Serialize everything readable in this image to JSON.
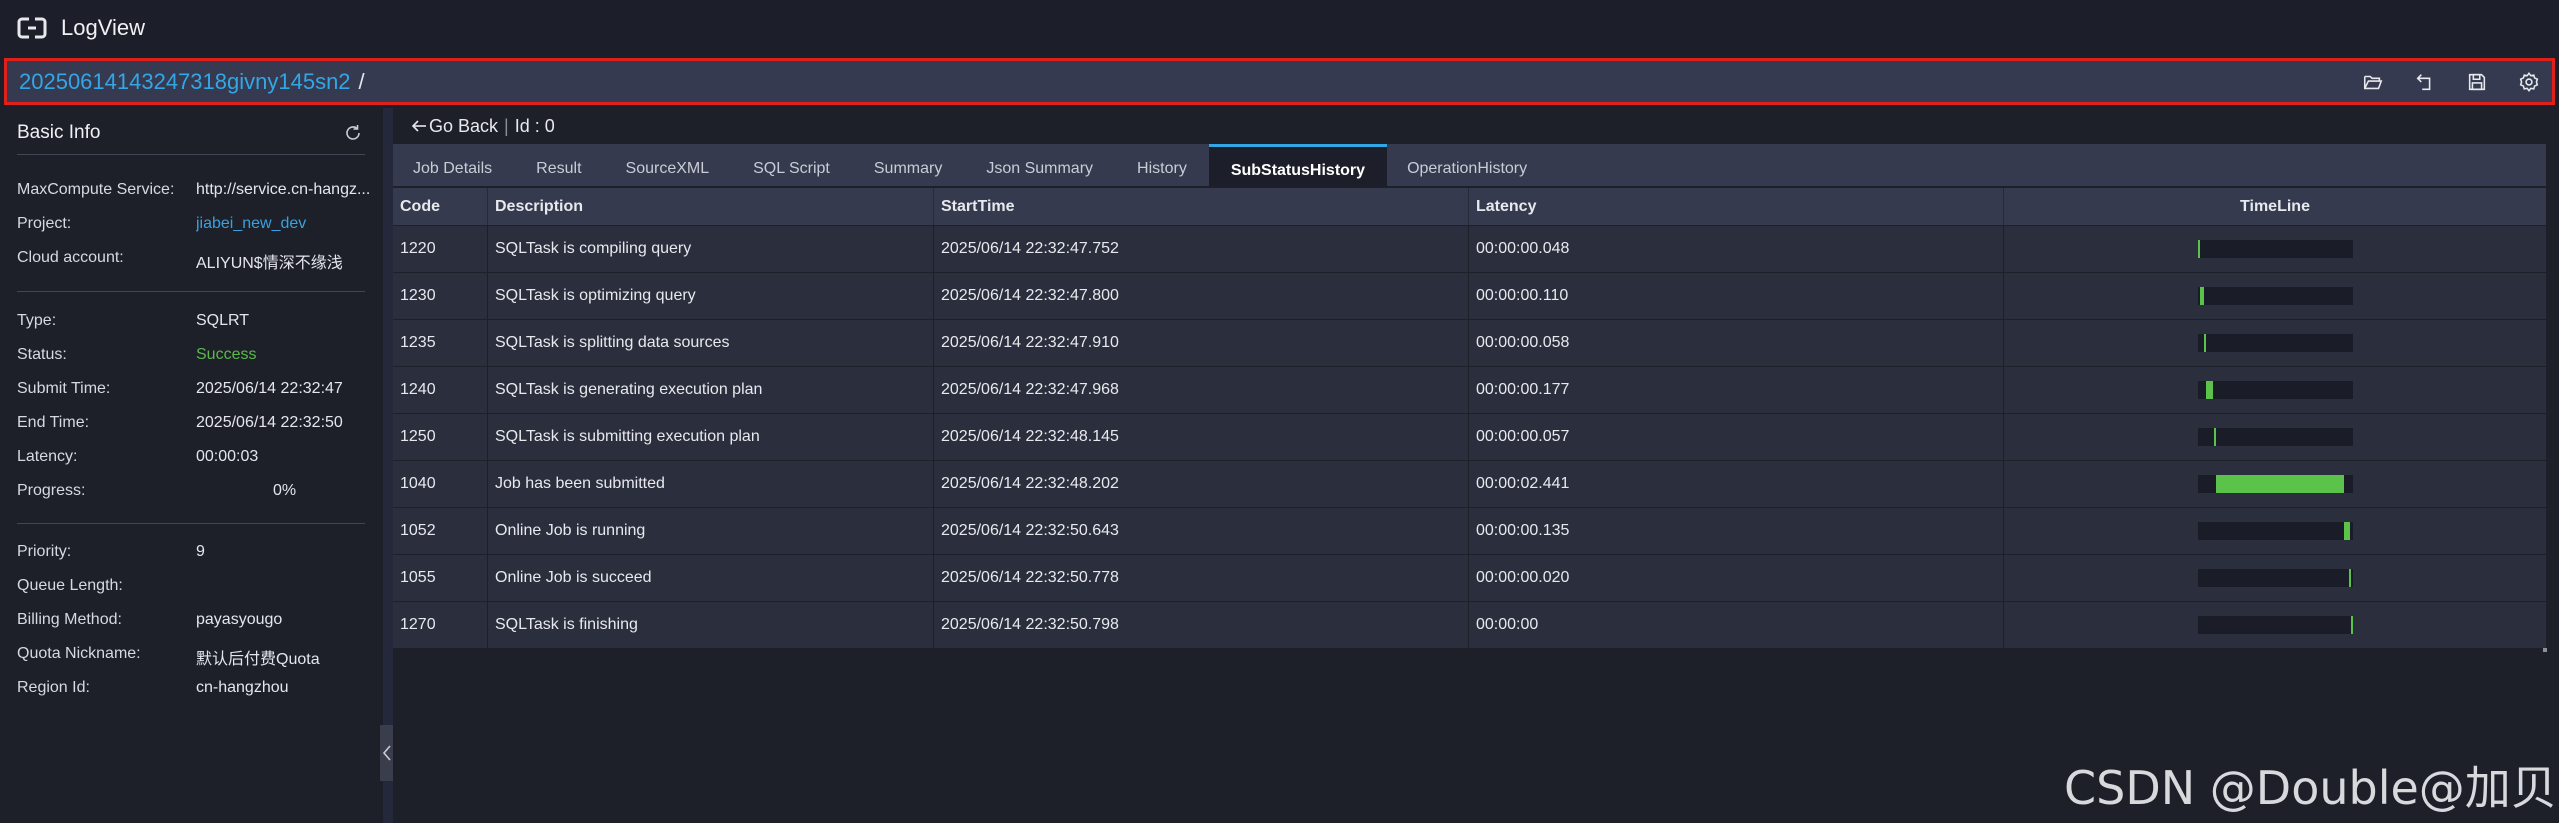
{
  "app": {
    "title": "LogView"
  },
  "path": {
    "job_id": "20250614143247318givny145sn2",
    "separator": "/"
  },
  "toolbar": [
    "folder-open-icon",
    "return-icon",
    "save-icon",
    "settings-icon"
  ],
  "sidebar": {
    "title": "Basic Info",
    "groups": [
      [
        {
          "label": "MaxCompute Service:",
          "value": "http://service.cn-hangz..."
        },
        {
          "label": "Project:",
          "value": "jiabei_new_dev",
          "style": "link"
        },
        {
          "label": "Cloud account:",
          "value": "ALIYUN$情深不缘浅"
        }
      ],
      [
        {
          "label": "Type:",
          "value": "SQLRT"
        },
        {
          "label": "Status:",
          "value": "Success",
          "style": "success"
        },
        {
          "label": "Submit Time:",
          "value": "2025/06/14 22:32:47"
        },
        {
          "label": "End Time:",
          "value": "2025/06/14 22:32:50"
        },
        {
          "label": "Latency:",
          "value": "00:00:03"
        },
        {
          "label": "Progress:",
          "value": "0%",
          "style": "progress"
        }
      ],
      [
        {
          "label": "Priority:",
          "value": "9"
        },
        {
          "label": "Queue Length:",
          "value": ""
        },
        {
          "label": "Billing Method:",
          "value": "payasyougo"
        },
        {
          "label": "Quota Nickname:",
          "value": "默认后付费Quota"
        },
        {
          "label": "Region Id:",
          "value": "cn-hangzhou"
        }
      ]
    ]
  },
  "main": {
    "go_back": "Go Back",
    "separator": "|",
    "id_text": "Id : 0",
    "tabs": [
      "Job Details",
      "Result",
      "SourceXML",
      "SQL Script",
      "Summary",
      "Json Summary",
      "History",
      "SubStatusHistory",
      "OperationHistory"
    ],
    "active_tab": 7,
    "table": {
      "columns": [
        "Code",
        "Description",
        "StartTime",
        "Latency",
        "TimeLine"
      ],
      "rows": [
        {
          "code": "1220",
          "description": "SQLTask is compiling query",
          "start": "2025/06/14 22:32:47.752",
          "latency": "00:00:00.048",
          "timeline": [
            0.0,
            0.013
          ]
        },
        {
          "code": "1230",
          "description": "SQLTask is optimizing query",
          "start": "2025/06/14 22:32:47.800",
          "latency": "00:00:00.110",
          "timeline": [
            0.013,
            0.036
          ]
        },
        {
          "code": "1235",
          "description": "SQLTask is splitting data sources",
          "start": "2025/06/14 22:32:47.910",
          "latency": "00:00:00.058",
          "timeline": [
            0.036,
            0.052
          ]
        },
        {
          "code": "1240",
          "description": "SQLTask is generating execution plan",
          "start": "2025/06/14 22:32:47.968",
          "latency": "00:00:00.177",
          "timeline": [
            0.052,
            0.1
          ]
        },
        {
          "code": "1250",
          "description": "SQLTask is submitting execution plan",
          "start": "2025/06/14 22:32:48.145",
          "latency": "00:00:00.057",
          "timeline": [
            0.1,
            0.116
          ]
        },
        {
          "code": "1040",
          "description": "Job has been submitted",
          "start": "2025/06/14 22:32:48.202",
          "latency": "00:00:02.441",
          "timeline": [
            0.116,
            0.941
          ]
        },
        {
          "code": "1052",
          "description": "Online Job is running",
          "start": "2025/06/14 22:32:50.643",
          "latency": "00:00:00.135",
          "timeline": [
            0.941,
            0.977
          ]
        },
        {
          "code": "1055",
          "description": "Online Job is succeed",
          "start": "2025/06/14 22:32:50.778",
          "latency": "00:00:00.020",
          "timeline": [
            0.977,
            0.985
          ]
        },
        {
          "code": "1270",
          "description": "SQLTask is finishing",
          "start": "2025/06/14 22:32:50.798",
          "latency": "00:00:00",
          "timeline": [
            0.985,
            0.993
          ]
        }
      ]
    }
  },
  "colors": {
    "accent": "#33a6e6",
    "success": "#5bb94a",
    "timeline": "#5bc24a",
    "highlight_border": "#e0201b"
  },
  "watermark": "CSDN @Double@加贝"
}
